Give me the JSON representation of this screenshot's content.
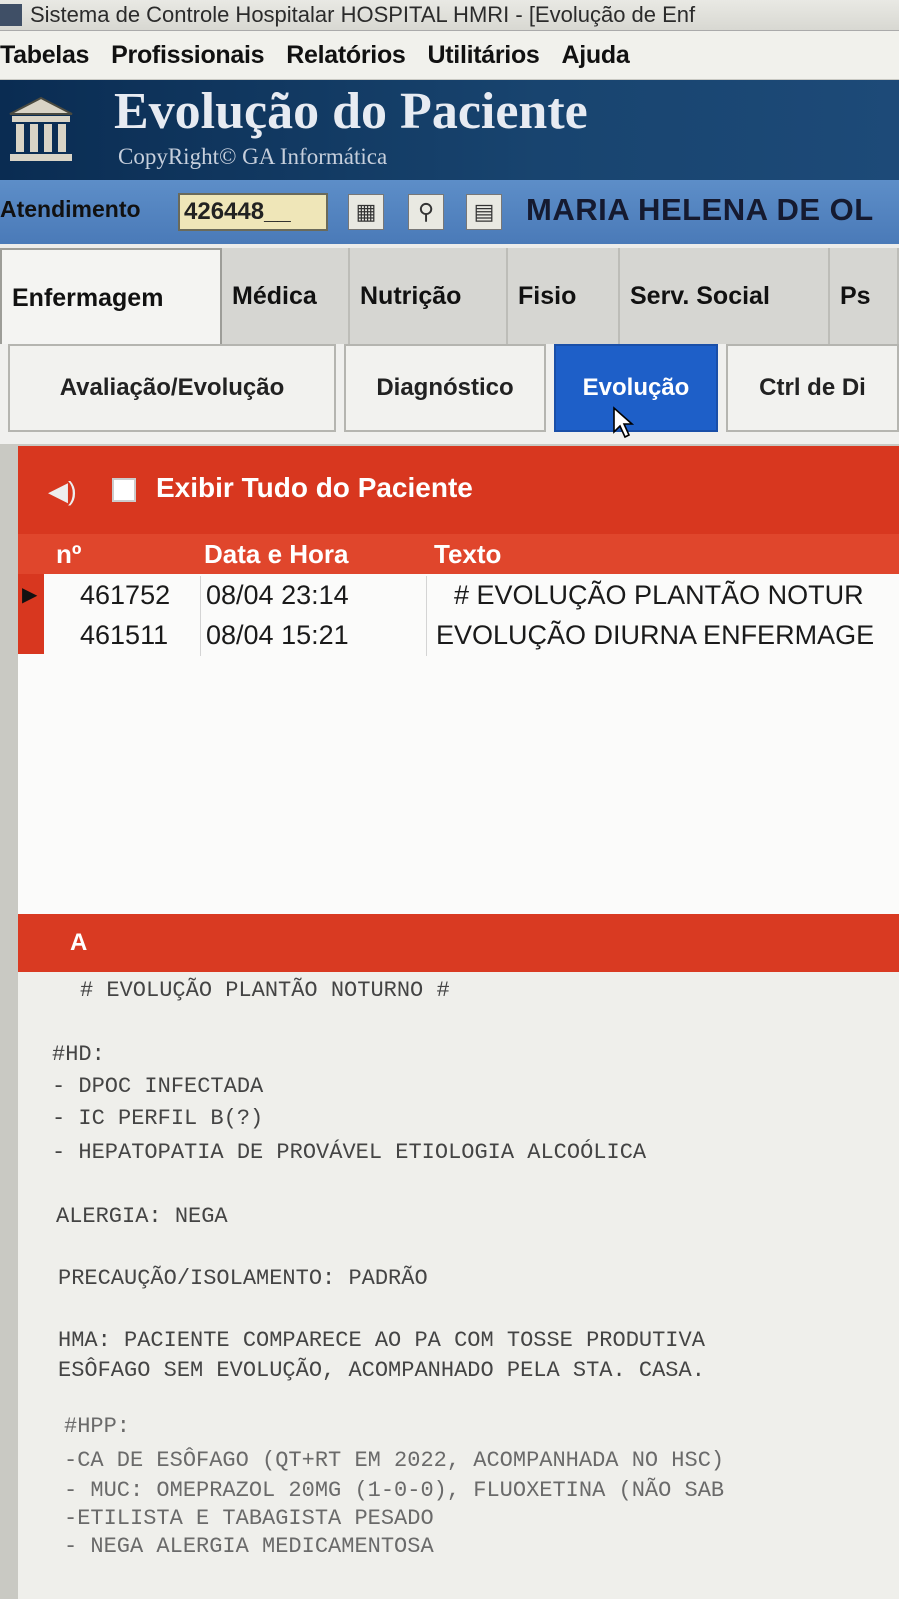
{
  "window": {
    "title": "Sistema de Controle Hospitalar HOSPITAL HMRI - [Evolução de Enf"
  },
  "menu": [
    "Tabelas",
    "Profissionais",
    "Relatórios",
    "Utilitários",
    "Ajuda"
  ],
  "banner": {
    "title": "Evolução do Paciente",
    "copyright": "CopyRight© GA Informática"
  },
  "atendimento": {
    "label": "Atendimento",
    "value": "426448__",
    "patient": "MARIA HELENA DE OL"
  },
  "main_tabs": [
    "Enfermagem",
    "Médica",
    "Nutrição",
    "Fisio",
    "Serv. Social",
    "Ps"
  ],
  "sub_tabs": [
    "Avaliação/Evolução",
    "Diagnóstico",
    "Evolução",
    "Ctrl de Di"
  ],
  "grid": {
    "show_all_label": "Exibir Tudo do Paciente",
    "columns": [
      "nº",
      "Data e Hora",
      "Texto"
    ],
    "rows": [
      {
        "num": "461752",
        "datetime": "08/04 23:14",
        "text": "# EVOLUÇÃO PLANTÃO NOTUR"
      },
      {
        "num": "461511",
        "datetime": "08/04 15:21",
        "text": "EVOLUÇÃO DIURNA ENFERMAGE"
      }
    ]
  },
  "section": {
    "label": "A"
  },
  "evolution_text": {
    "l1": "# EVOLUÇÃO PLANTÃO NOTURNO #",
    "l2": "#HD:",
    "l3": "- DPOC INFECTADA",
    "l4": "- IC PERFIL B(?)",
    "l5": "- HEPATOPATIA DE PROVÁVEL ETIOLOGIA ALCOÓLICA",
    "l6": "ALERGIA: NEGA",
    "l7": "PRECAUÇÃO/ISOLAMENTO: PADRÃO",
    "l8": "HMA: PACIENTE COMPARECE AO PA COM TOSSE PRODUTIVA",
    "l9": "ESÔFAGO SEM EVOLUÇÃO, ACOMPANHADO PELA STA. CASA.",
    "l10": "#HPP:",
    "l11": "-CA DE ESÔFAGO (QT+RT EM 2022, ACOMPANHADA NO HSC)",
    "l12": "- MUC: OMEPRAZOL 20MG (1-0-0), FLUOXETINA (NÃO SAB",
    "l13": "-ETILISTA E TABAGISTA PESADO",
    "l14": "- NEGA ALERGIA MEDICAMENTOSA"
  }
}
